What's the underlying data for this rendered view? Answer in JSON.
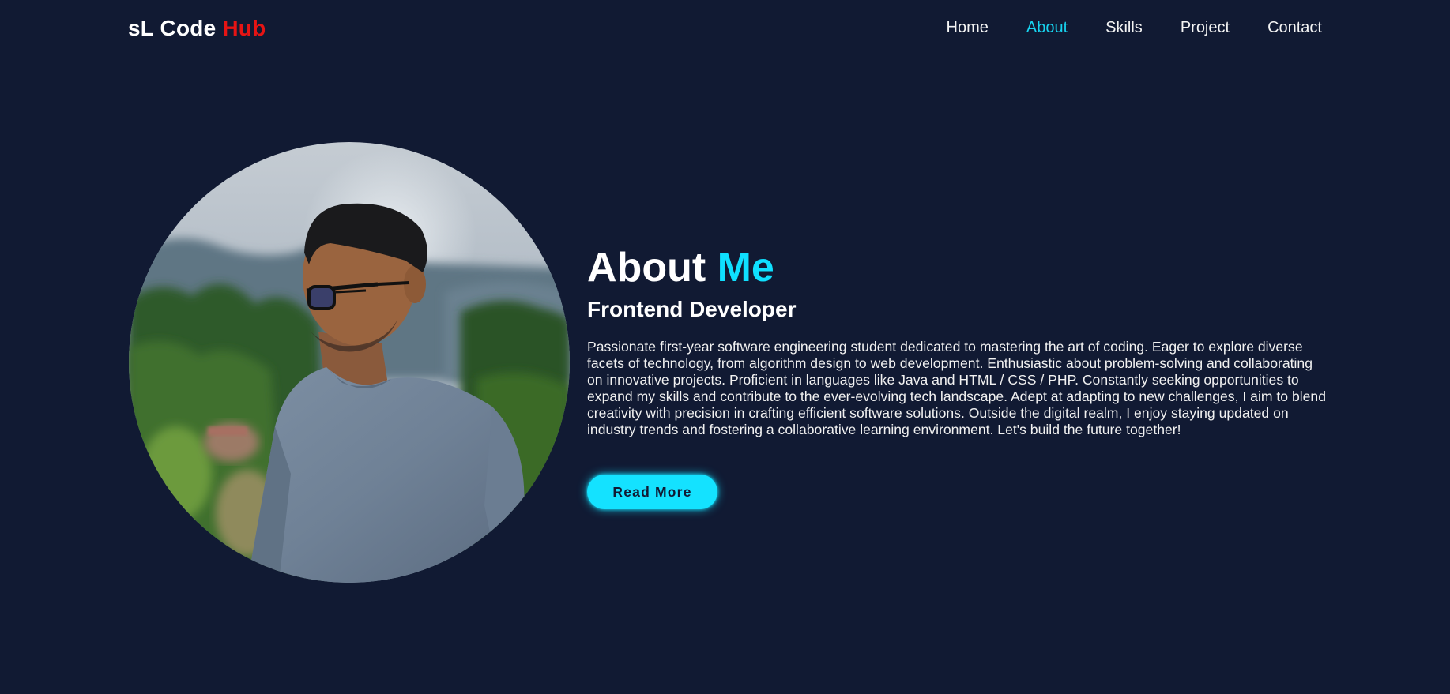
{
  "header": {
    "logo_main": "sL Code ",
    "logo_accent": "Hub",
    "nav": [
      {
        "label": "Home",
        "active": false
      },
      {
        "label": "About",
        "active": true
      },
      {
        "label": "Skills",
        "active": false
      },
      {
        "label": "Project",
        "active": false
      },
      {
        "label": "Contact",
        "active": false
      }
    ]
  },
  "about": {
    "title_main": "About ",
    "title_accent": "Me",
    "subtitle": "Frontend Developer",
    "description": "Passionate first-year software engineering student dedicated to mastering the art of coding. Eager to explore diverse facets of technology, from algorithm design to web development. Enthusiastic about problem-solving and collaborating on innovative projects. Proficient in languages like Java and HTML / CSS / PHP. Constantly seeking opportunities to expand my skills and contribute to the ever-evolving tech landscape. Adept at adapting to new challenges, I aim to blend creativity with precision in crafting efficient software solutions. Outside the digital realm, I enjoy staying updated on industry trends and fostering a collaborative learning environment. Let's build the future together!",
    "button_label": "Read More"
  },
  "colors": {
    "background": "#111a33",
    "accent_cyan": "#0fe0ff",
    "accent_red": "#e61414"
  },
  "icons": {
    "profile_image": "profile-photo"
  }
}
